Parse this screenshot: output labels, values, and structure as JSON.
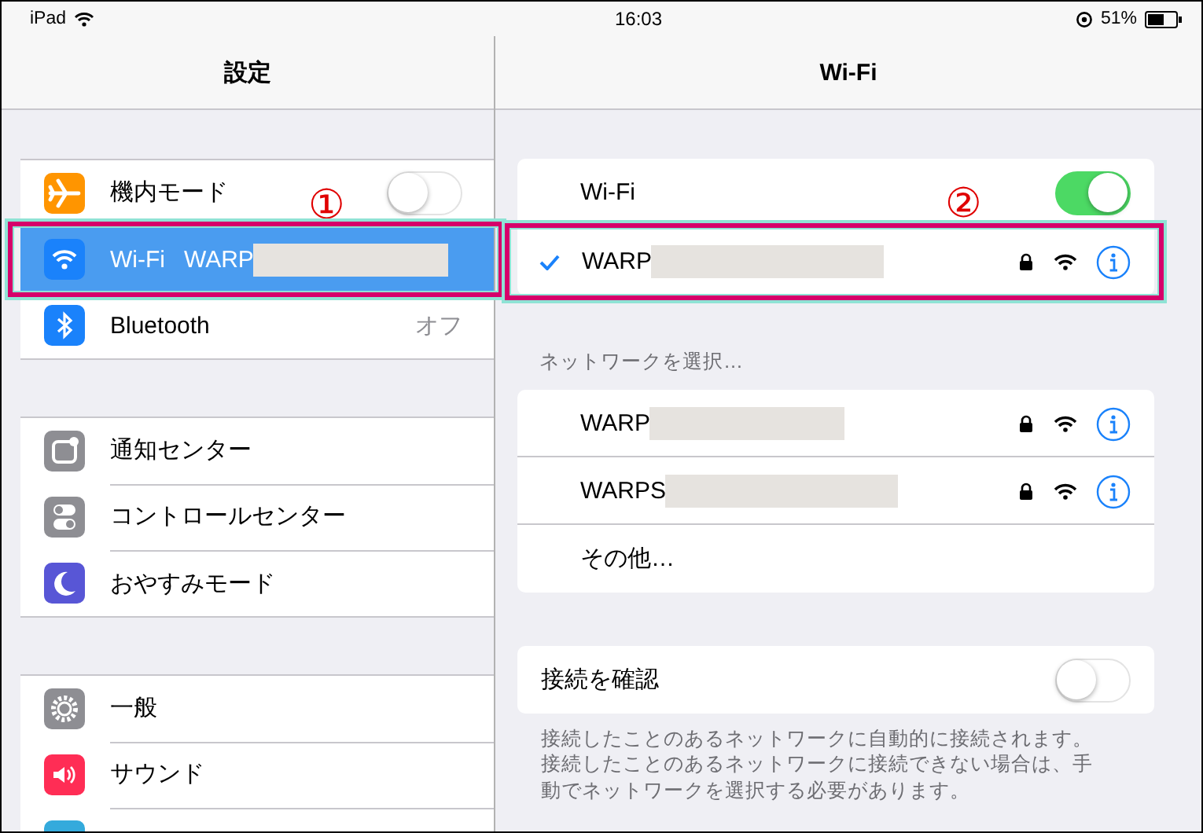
{
  "status_bar": {
    "device": "iPad",
    "time": "16:03",
    "battery": "51%"
  },
  "sidebar": {
    "title": "設定",
    "groups": [
      {
        "items": [
          {
            "label": "機内モード",
            "kind": "toggle",
            "on": false,
            "selected": false,
            "color": "#ff9500"
          },
          {
            "label": "Wi-Fi",
            "kind": "value",
            "value": "WARP",
            "selected": true,
            "color": "#1a82fb",
            "callout": "①"
          },
          {
            "label": "Bluetooth",
            "kind": "value",
            "value": "オフ",
            "selected": false,
            "color": "#1a82fb"
          }
        ]
      },
      {
        "items": [
          {
            "label": "通知センター",
            "kind": "plain",
            "selected": false,
            "color": "#8e8e93"
          },
          {
            "label": "コントロールセンター",
            "kind": "plain",
            "selected": false,
            "color": "#8e8e93"
          },
          {
            "label": "おやすみモード",
            "kind": "plain",
            "selected": false,
            "color": "#5856d6"
          }
        ]
      },
      {
        "items": [
          {
            "label": "一般",
            "kind": "plain",
            "selected": false,
            "color": "#8e8e93"
          },
          {
            "label": "サウンド",
            "kind": "plain",
            "selected": false,
            "color": "#ff2d55"
          },
          {
            "kind": "plain",
            "selected": false,
            "color": "#34aadc"
          }
        ]
      }
    ]
  },
  "detail": {
    "title": "Wi-Fi",
    "wifi_toggle": {
      "label": "Wi-Fi",
      "on": true
    },
    "connected": {
      "name": "WARP",
      "checked": true,
      "callout": "②"
    },
    "section_header": "ネットワークを選択…",
    "networks": [
      {
        "name": "WARP",
        "kind": "network"
      },
      {
        "name": "WARPS",
        "kind": "network"
      },
      {
        "name": "その他…",
        "kind": "other"
      }
    ],
    "ask_to_join": {
      "label": "接続を確認",
      "on": false
    },
    "footer": "接続したことのあるネットワークに自動的に接続されます。接続したことのあるネットワークに接続できない場合は、手動でネットワークを選択する必要があります。"
  }
}
